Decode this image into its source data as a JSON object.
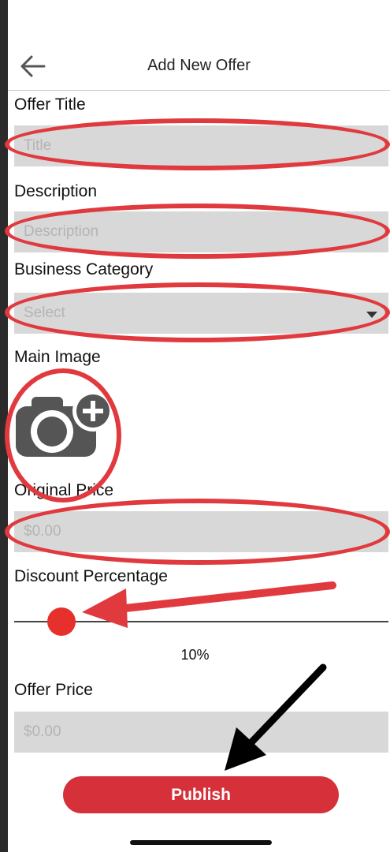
{
  "header": {
    "title": "Add New Offer",
    "back_icon": "arrow-left-icon"
  },
  "form": {
    "offer_title": {
      "label": "Offer Title",
      "placeholder": "Title"
    },
    "description": {
      "label": "Description",
      "placeholder": "Description"
    },
    "business_category": {
      "label": "Business Category",
      "selected": "Select"
    },
    "main_image": {
      "label": "Main Image",
      "icon": "camera-add-icon"
    },
    "original_price": {
      "label": "Original Price",
      "placeholder": "$0.00"
    },
    "discount": {
      "label": "Discount Percentage",
      "value_text": "10%",
      "value": 10
    },
    "offer_price": {
      "label": "Offer Price",
      "value": "$0.00"
    },
    "publish_label": "Publish"
  },
  "colors": {
    "accent": "#d6303a",
    "annotation": "#e03a3f",
    "field_bg": "#d8d8d8"
  }
}
